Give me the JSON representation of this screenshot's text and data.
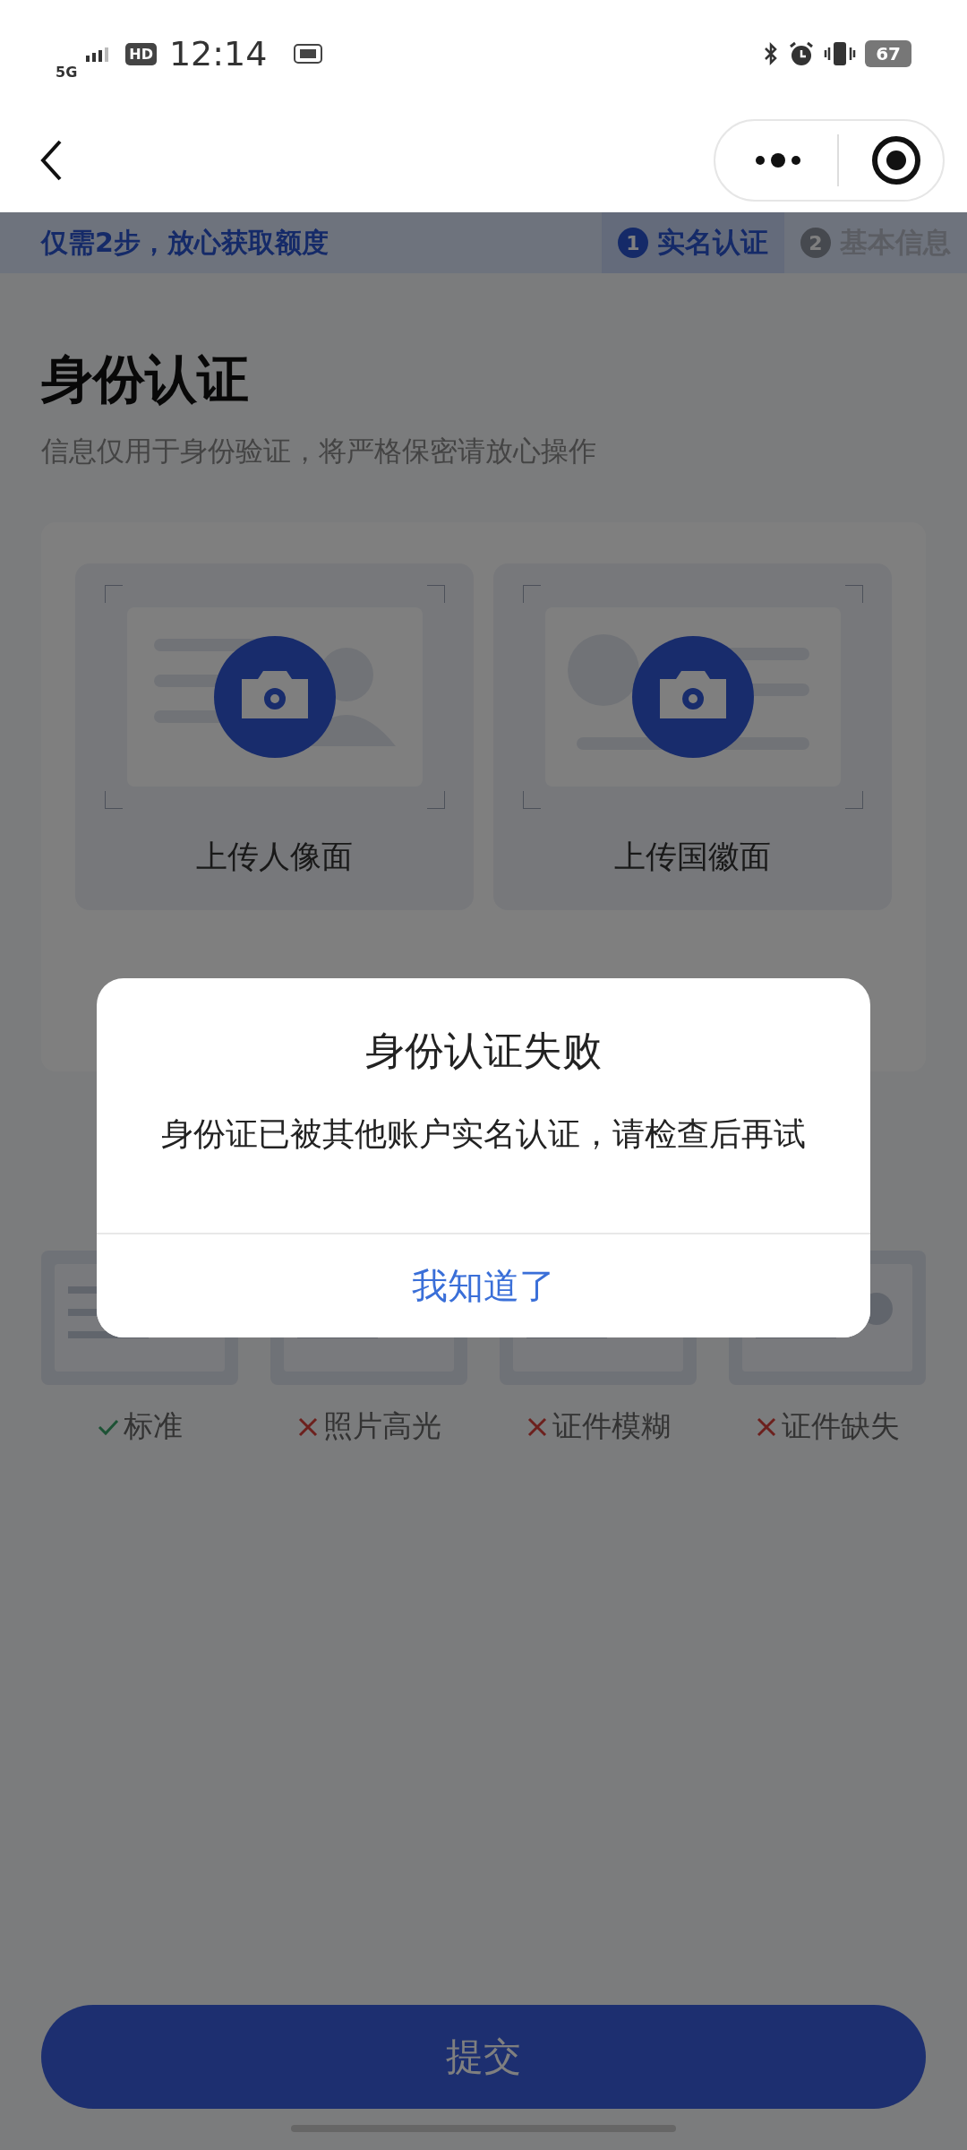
{
  "status_bar": {
    "network": "5G",
    "hd": "HD",
    "time": "12:14",
    "battery": "67"
  },
  "steps_bar": {
    "slogan": "仅需2步，放心获取额度",
    "steps": [
      {
        "number": "1",
        "label": "实名认证",
        "selected": true
      },
      {
        "number": "2",
        "label": "基本信息",
        "selected": false
      }
    ]
  },
  "header": {
    "title": "身份认证",
    "subtitle": "信息仅用于身份验证，将严格保密请放心操作"
  },
  "uploads": [
    {
      "kind": "portrait",
      "label": "上传人像面"
    },
    {
      "kind": "emblem",
      "label": "上传国徽面"
    }
  ],
  "examples": [
    {
      "label": "标准",
      "valid": true
    },
    {
      "label": "照片高光",
      "valid": false
    },
    {
      "label": "证件模糊",
      "valid": false
    },
    {
      "label": "证件缺失",
      "valid": false
    }
  ],
  "submit_button": "提交",
  "dialog": {
    "title": "身份认证失败",
    "message": "身份证已被其他账户实名认证，请检查后再试",
    "button": "我知道了"
  }
}
